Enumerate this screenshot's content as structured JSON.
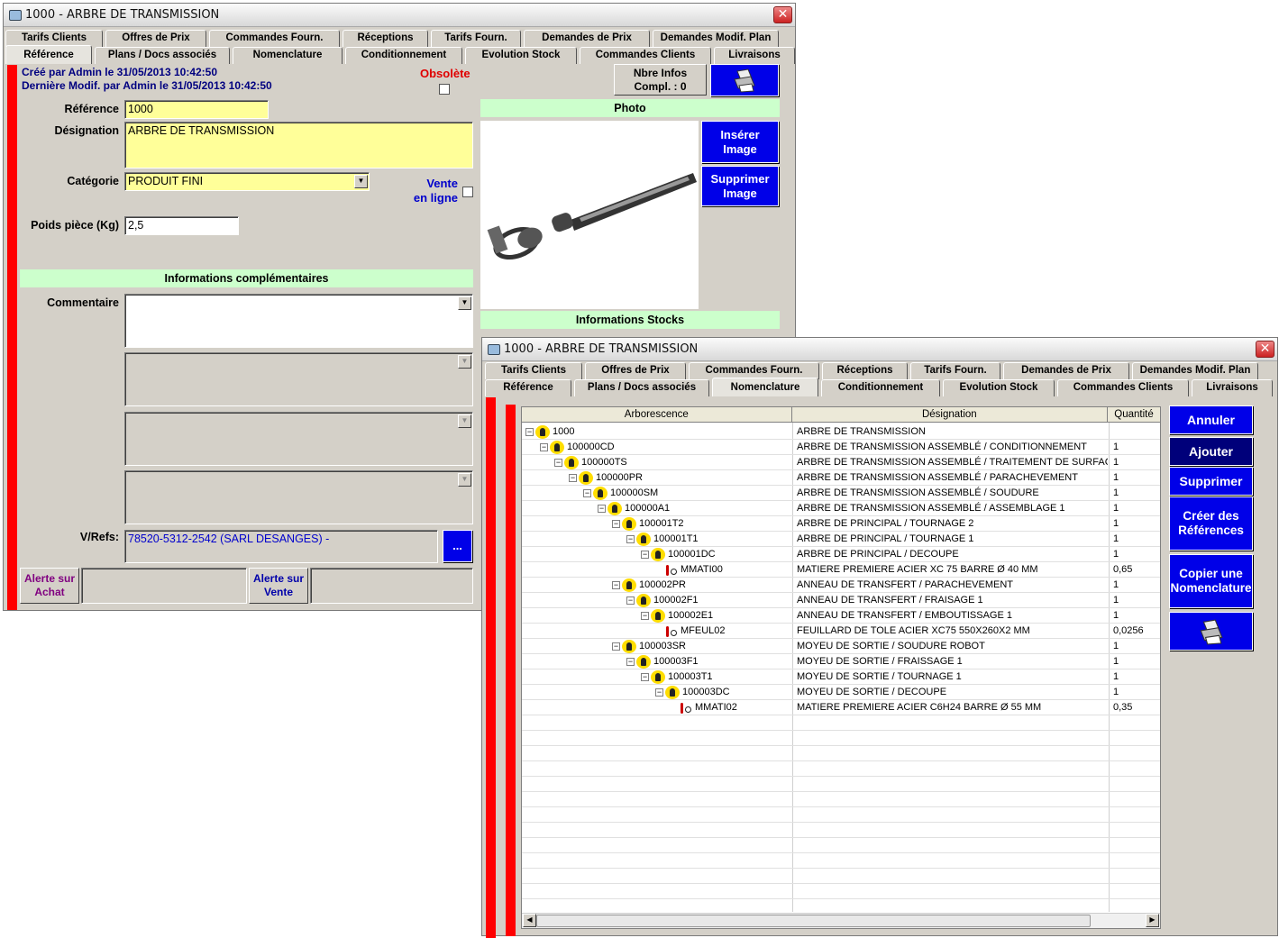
{
  "win1": {
    "title": "1000 - ARBRE DE TRANSMISSION",
    "close": "✕",
    "tabs_row1": [
      "Tarifs Clients",
      "Offres de Prix",
      "Commandes Fourn.",
      "Réceptions",
      "Tarifs Fourn.",
      "Demandes de Prix",
      "Demandes Modif. Plan"
    ],
    "tabs_row2": [
      "Référence",
      "Plans / Docs associés",
      "Nomenclature",
      "Conditionnement",
      "Evolution Stock",
      "Commandes Clients",
      "Livraisons"
    ],
    "created": "Créé par Admin le 31/05/2013 10:42:50",
    "modified": "Dernière Modif. par Admin le 31/05/2013 10:42:50",
    "obsolete_label": "Obsolète",
    "nbre_infos": "Nbre Infos",
    "compl": "Compl. : 0",
    "reference_label": "Référence",
    "reference_value": "1000",
    "designation_label": "Désignation",
    "designation_value": "ARBRE DE TRANSMISSION",
    "categorie_label": "Catégorie",
    "categorie_value": "PRODUIT FINI",
    "vente_line1": "Vente",
    "vente_line2": "en ligne",
    "poids_label": "Poids pièce (Kg)",
    "poids_value": "2,5",
    "photo_label": "Photo",
    "inserer_l1": "Insérer",
    "inserer_l2": "Image",
    "supprimer_l1": "Supprimer",
    "supprimer_l2": "Image",
    "infos_compl": "Informations complémentaires",
    "infos_stocks": "Informations Stocks",
    "commentaire_label": "Commentaire",
    "vrefs_label": "V/Refs:",
    "vrefs_value": "78520-5312-2542 (SARL DESANGES) -",
    "dots": "...",
    "alerte_achat_l1": "Alerte sur",
    "alerte_achat_l2": "Achat",
    "alerte_vente_l1": "Alerte sur",
    "alerte_vente_l2": "Vente"
  },
  "win2": {
    "title": "1000 - ARBRE DE TRANSMISSION",
    "close": "✕",
    "tabs_row1": [
      "Tarifs Clients",
      "Offres de Prix",
      "Commandes Fourn.",
      "Réceptions",
      "Tarifs Fourn.",
      "Demandes de Prix",
      "Demandes Modif. Plan"
    ],
    "tabs_row2": [
      "Référence",
      "Plans / Docs associés",
      "Nomenclature",
      "Conditionnement",
      "Evolution Stock",
      "Commandes Clients",
      "Livraisons"
    ],
    "col_arbo": "Arborescence",
    "col_desig": "Désignation",
    "col_qte": "Quantité",
    "btn_annuler": "Annuler",
    "btn_ajouter": "Ajouter",
    "btn_supprimer": "Supprimer",
    "btn_creer_l1": "Créer des",
    "btn_creer_l2": "Références",
    "btn_copier_l1": "Copier une",
    "btn_copier_l2": "Nomenclature",
    "rows": [
      {
        "level": 0,
        "code": "1000",
        "kind": "asm",
        "desig": "ARBRE DE TRANSMISSION",
        "qty": ""
      },
      {
        "level": 1,
        "code": "100000CD",
        "kind": "asm",
        "desig": "ARBRE DE TRANSMISSION ASSEMBLÉ   / CONDITIONNEMENT",
        "qty": "1"
      },
      {
        "level": 2,
        "code": "100000TS",
        "kind": "asm",
        "desig": "ARBRE DE TRANSMISSION ASSEMBLÉ   / TRAITEMENT DE SURFACE",
        "qty": "1"
      },
      {
        "level": 3,
        "code": "100000PR",
        "kind": "asm",
        "desig": "ARBRE DE TRANSMISSION ASSEMBLÉ   / PARACHEVEMENT",
        "qty": "1"
      },
      {
        "level": 4,
        "code": "100000SM",
        "kind": "asm",
        "desig": "ARBRE DE TRANSMISSION ASSEMBLÉ   / SOUDURE",
        "qty": "1"
      },
      {
        "level": 5,
        "code": "100000A1",
        "kind": "asm",
        "desig": "ARBRE DE TRANSMISSION ASSEMBLÉ   / ASSEMBLAGE 1",
        "qty": "1"
      },
      {
        "level": 6,
        "code": "100001T2",
        "kind": "asm",
        "desig": "ARBRE DE PRINCIPAL / TOURNAGE 2",
        "qty": "1"
      },
      {
        "level": 7,
        "code": "100001T1",
        "kind": "asm",
        "desig": "ARBRE DE PRINCIPAL / TOURNAGE 1",
        "qty": "1"
      },
      {
        "level": 8,
        "code": "100001DC",
        "kind": "asm",
        "desig": "ARBRE DE PRINCIPAL / DECOUPE",
        "qty": "1"
      },
      {
        "level": 9,
        "code": "MMATI00",
        "kind": "mat",
        "desig": "MATIERE PREMIERE ACIER XC 75 BARRE Ø 40 MM",
        "qty": "0,65"
      },
      {
        "level": 6,
        "code": "100002PR",
        "kind": "asm",
        "desig": "ANNEAU DE TRANSFERT / PARACHEVEMENT",
        "qty": "1"
      },
      {
        "level": 7,
        "code": "100002F1",
        "kind": "asm",
        "desig": "ANNEAU DE TRANSFERT / FRAISAGE 1",
        "qty": "1"
      },
      {
        "level": 8,
        "code": "100002E1",
        "kind": "asm",
        "desig": "ANNEAU DE TRANSFERT / EMBOUTISSAGE 1",
        "qty": "1"
      },
      {
        "level": 9,
        "code": "MFEUL02",
        "kind": "mat",
        "desig": "FEUILLARD DE TOLE ACIER XC75 550X260X2 MM",
        "qty": "0,0256"
      },
      {
        "level": 6,
        "code": "100003SR",
        "kind": "asm",
        "desig": "MOYEU DE SORTIE / SOUDURE ROBOT",
        "qty": "1"
      },
      {
        "level": 7,
        "code": "100003F1",
        "kind": "asm",
        "desig": "MOYEU DE SORTIE / FRAISSAGE 1",
        "qty": "1"
      },
      {
        "level": 8,
        "code": "100003T1",
        "kind": "asm",
        "desig": "MOYEU DE SORTIE / TOURNAGE 1",
        "qty": "1"
      },
      {
        "level": 9,
        "code": "100003DC",
        "kind": "asm",
        "desig": "MOYEU DE SORTIE / DECOUPE",
        "qty": "1"
      },
      {
        "level": 10,
        "code": "MMATI02",
        "kind": "mat",
        "desig": "MATIERE PREMIERE ACIER C6H24 BARRE Ø 55 MM",
        "qty": "0,35"
      }
    ]
  }
}
